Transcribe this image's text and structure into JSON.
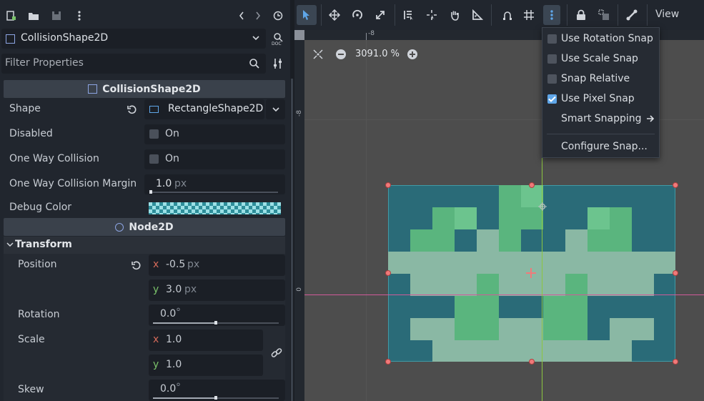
{
  "inspector": {
    "node_selector": "CollisionShape2D",
    "filter_placeholder": "Filter Properties",
    "section_main": "CollisionShape2D",
    "props": {
      "shape_label": "Shape",
      "shape_value": "RectangleShape2D",
      "disabled_label": "Disabled",
      "disabled_value": "On",
      "one_way_label": "One Way Collision",
      "one_way_value": "On",
      "margin_label": "One Way Collision Margin",
      "margin_value": "1.0",
      "margin_unit": "px",
      "debug_color_label": "Debug Color"
    },
    "section_node2d": "Node2D",
    "transform_label": "Transform",
    "position_label": "Position",
    "position_x": "-0.5",
    "position_y": "3.0",
    "position_unit": "px",
    "axis_x": "x",
    "axis_y": "y",
    "rotation_label": "Rotation",
    "rotation_value": "0.0",
    "rotation_unit": "°",
    "scale_label": "Scale",
    "scale_x": "1.0",
    "scale_y": "1.0",
    "skew_label": "Skew",
    "skew_value": "0.0",
    "skew_unit": "°"
  },
  "toolbar": {
    "view_label": "View"
  },
  "viewport": {
    "zoom": "3091.0 %",
    "ruler_h_label": "-8",
    "ruler_v_top": "-8",
    "ruler_v_mid": "0"
  },
  "snap_menu": {
    "items": [
      {
        "label": "Use Rotation Snap",
        "checked": false
      },
      {
        "label": "Use Scale Snap",
        "checked": false
      },
      {
        "label": "Snap Relative",
        "checked": false
      },
      {
        "label": "Use Pixel Snap",
        "checked": true
      },
      {
        "label": "Smart Snapping"
      },
      {
        "label": "Configure Snap..."
      }
    ]
  },
  "colors": {
    "accent": "#5fa6e8",
    "selection_fill": "#2a6b78",
    "sprite_green": "#5ab57e",
    "sprite_light": "#8ab8a4"
  }
}
